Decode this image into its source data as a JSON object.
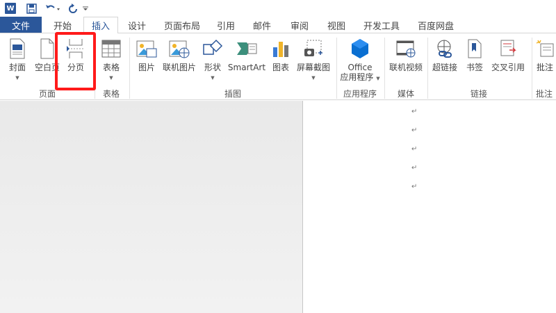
{
  "qat": {
    "app_logo": "W",
    "icons": [
      "word-logo",
      "save-icon",
      "undo-icon",
      "redo-icon",
      "customize-icon"
    ]
  },
  "tabs": {
    "file": "文件",
    "items": [
      "开始",
      "插入",
      "设计",
      "页面布局",
      "引用",
      "邮件",
      "审阅",
      "视图",
      "开发工具",
      "百度网盘"
    ],
    "active": "插入"
  },
  "ribbon": {
    "buttons": {
      "cover": "封面",
      "blank_page": "空白页",
      "page_break": "分页",
      "table": "表格",
      "pictures": "图片",
      "online_pictures": "联机图片",
      "shapes": "形状",
      "smartart": "SmartArt",
      "chart": "图表",
      "screenshot": "屏幕截图",
      "office_apps_line1": "Office",
      "office_apps_line2": "应用程序",
      "online_video": "联机视频",
      "hyperlink": "超链接",
      "bookmark": "书签",
      "cross_reference": "交叉引用",
      "comment": "批注"
    },
    "groups": {
      "pages": "页面",
      "tables": "表格",
      "illustrations": "插图",
      "apps": "应用程序",
      "media": "媒体",
      "links": "链接",
      "comments": "批注"
    }
  },
  "document": {
    "paragraph_mark": "↵",
    "empty_paragraphs": 5
  },
  "colors": {
    "accent": "#2b579a",
    "highlight": "#ff1a1a"
  }
}
